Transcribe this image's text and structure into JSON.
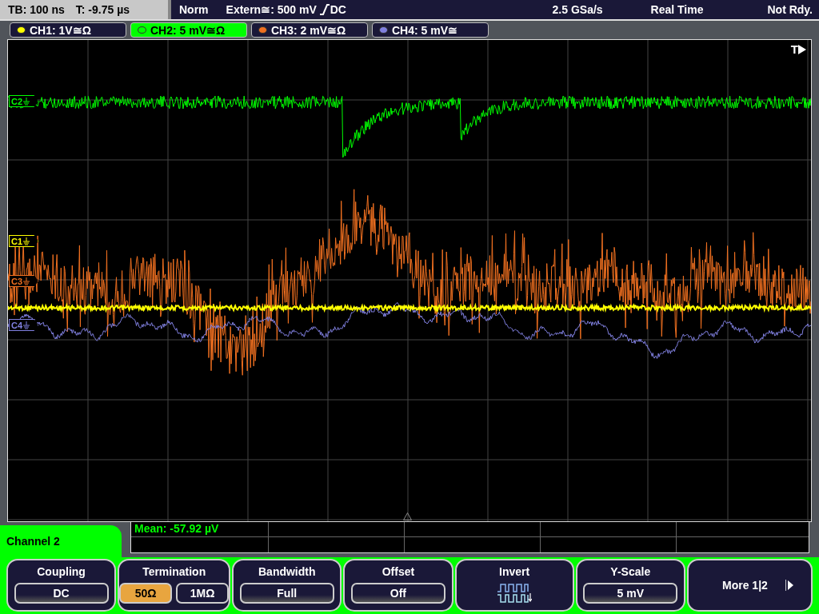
{
  "status_bar": {
    "timebase": "TB: 100 ns",
    "trigger_time": "T: -9.75 µs",
    "trigger_mode": "Norm",
    "trigger_source": "Extern≅: 500 mV",
    "trigger_coupling": "DC",
    "sample_rate": "2.5 GSa/s",
    "acquisition": "Real Time",
    "state": "Not Rdy."
  },
  "channels": [
    {
      "label": "CH1: 1V≅Ω",
      "color": "#ffff00",
      "selected": false
    },
    {
      "label": "CH2: 5 mV≅Ω",
      "color": "#00ff00",
      "selected": true
    },
    {
      "label": "CH3: 2 mV≅Ω",
      "color": "#f07020",
      "selected": false
    },
    {
      "label": "CH4: 5 mV≅",
      "color": "#8080e0",
      "selected": false
    }
  ],
  "trace_markers": [
    {
      "text": "C2",
      "color": "#00ff00"
    },
    {
      "text": "C1",
      "color": "#ffff00"
    },
    {
      "text": "C3",
      "color": "#f07020"
    },
    {
      "text": "C4",
      "color": "#8080e0"
    }
  ],
  "trigger_marker": "T",
  "measurement": {
    "text": "Mean: -57.92 µV"
  },
  "menu": {
    "title": "Channel 2",
    "softkeys": [
      {
        "kind": "value",
        "label": "Coupling",
        "value": "DC"
      },
      {
        "kind": "options",
        "label": "Termination",
        "options": [
          {
            "text": "50Ω",
            "selected": true
          },
          {
            "text": "1MΩ",
            "selected": false
          }
        ]
      },
      {
        "kind": "value",
        "label": "Bandwidth",
        "value": "Full"
      },
      {
        "kind": "value",
        "label": "Offset",
        "value": "Off"
      },
      {
        "kind": "icon",
        "label": "Invert"
      },
      {
        "kind": "value",
        "label": "Y-Scale",
        "value": "5 mV"
      },
      {
        "kind": "more",
        "label": "More 1|2"
      }
    ]
  }
}
